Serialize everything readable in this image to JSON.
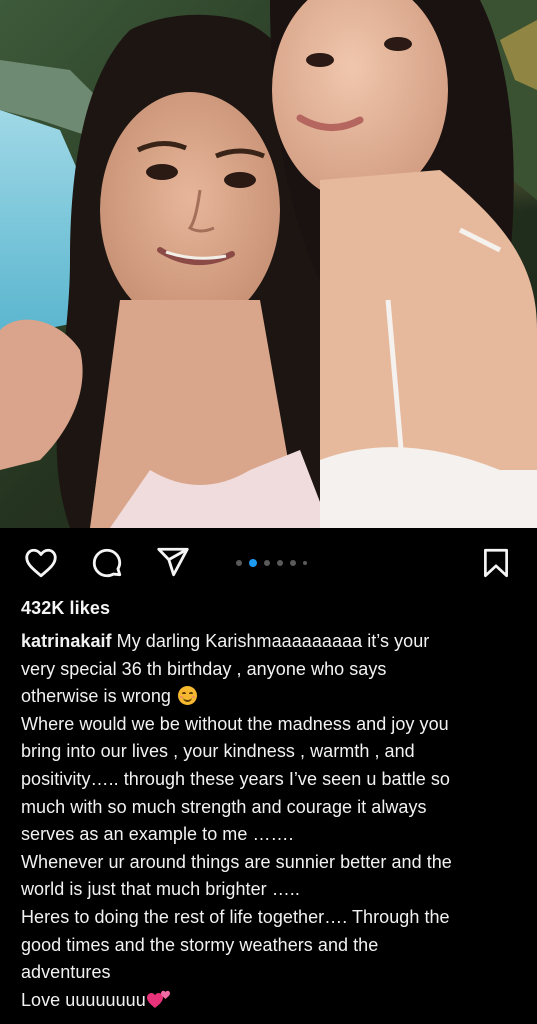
{
  "post": {
    "image_alt": "",
    "likes": "432K likes",
    "username": "katrinakaif",
    "caption_lines": [
      " My darling Karishmaaaaaaaaa it’s your",
      "very special 36 th birthday , anyone who says",
      "otherwise is wrong",
      "Where would we be without the madness and joy you",
      "bring into our lives , your kindness , warmth , and",
      "positivity….. through these years I’ve seen u battle so",
      "much with so much strength and courage it always",
      "serves as an example to me …….",
      "Whenever ur around things are sunnier better and the",
      "world is just that much brighter …..",
      "Heres to doing the rest of life together…. Through the",
      "good times and the stormy weathers and the",
      "adventures",
      "Love uuuuuuuu"
    ],
    "emojis": {
      "line3": "smiling-face-icon",
      "line14": "two-hearts-icon"
    }
  },
  "actions": {
    "like_icon": "heart-outline-icon",
    "comment_icon": "comment-bubble-icon",
    "share_icon": "paper-plane-icon",
    "save_icon": "bookmark-icon"
  },
  "carousel": {
    "count": 6,
    "active_index": 1
  },
  "colors": {
    "background": "#000000",
    "text": "#f5f5f5",
    "carousel_active": "#1e9bf0",
    "carousel_inactive": "#5a5a5a",
    "hearts": "#e8337a"
  }
}
